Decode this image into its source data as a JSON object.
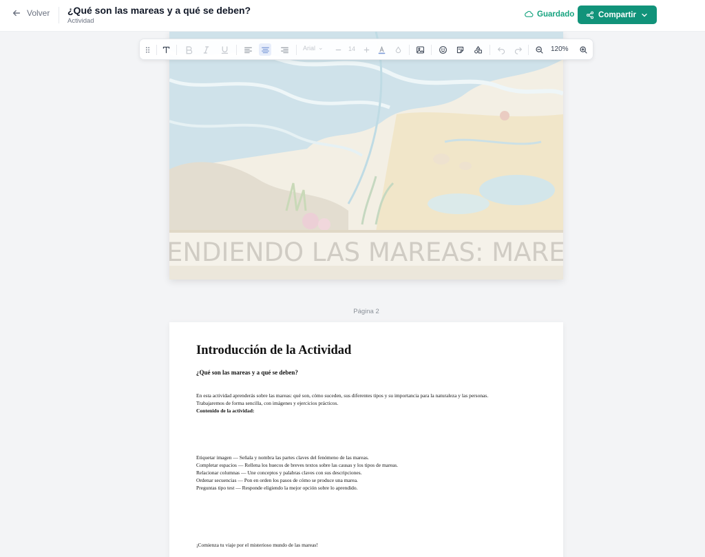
{
  "header": {
    "back_label": "Volver",
    "title": "¿Qué son las mareas y a qué se deben?",
    "subtitle": "Actividad",
    "saved_label": "Guardado",
    "share_label": "Compartir"
  },
  "toolbar": {
    "font_name": "Arial",
    "font_size": "14",
    "zoom": "120%"
  },
  "page1": {
    "banner_text": "ENDIENDO LAS MAREAS: MAREA ALTA Y MAR"
  },
  "page2": {
    "label": "Página 2",
    "heading": "Introducción de la Actividad",
    "question": "¿Qué son las mareas y a qué se deben?",
    "intro_line1": "En esta actividad aprenderás sobre las mareas: qué son, cómo suceden, sus diferentes tipos y su importancia para la naturaleza y las personas.",
    "intro_line2": "Trabajaremos de forma sencilla, con imágenes y ejercicios prácticos.",
    "contents_title": "Contenido de la actividad:",
    "items": [
      "Etiquetar imagen — Señala y nombra las partes claves del fenómeno de las mareas.",
      "Completar espacios — Rellena los huecos de breves textos sobre las causas y los tipos de mareas.",
      "Relacionar columnas — Une conceptos y palabras claves con sus descripciones.",
      "Ordenar secuencias — Pon en orden los pasos de cómo se produce una marea.",
      "Preguntas tipo test — Responde eligiendo la mejor opción sobre lo aprendido."
    ],
    "closing": "¡Comienza tu viaje por el misterioso mundo de las mareas!"
  },
  "colors": {
    "accent": "#11937a",
    "saved": "#16a37f"
  }
}
